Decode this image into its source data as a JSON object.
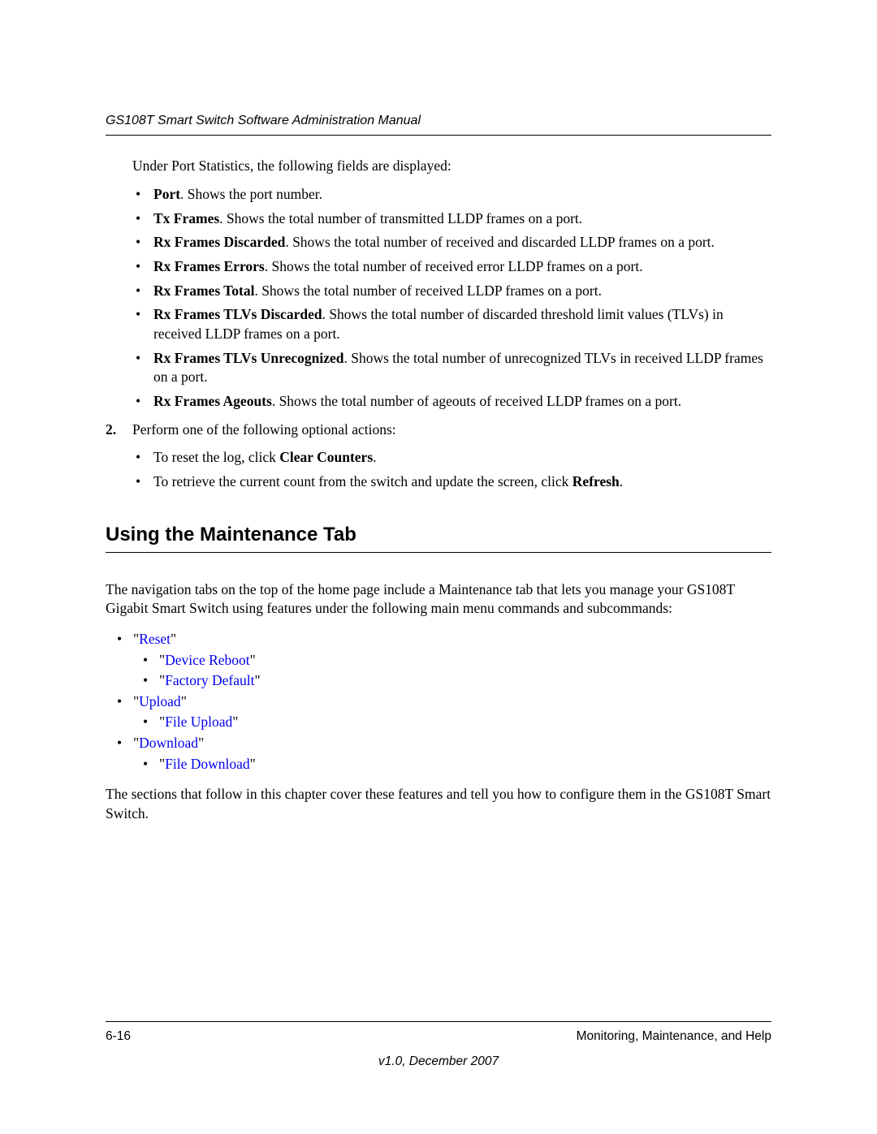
{
  "header": {
    "title": "GS108T Smart Switch Software Administration Manual"
  },
  "intro": "Under Port Statistics, the following fields are displayed:",
  "fields": [
    {
      "term": "Port",
      "desc": ". Shows the port number."
    },
    {
      "term": "Tx Frames",
      "desc": ". Shows the total number of transmitted LLDP frames on a port."
    },
    {
      "term": "Rx Frames Discarded",
      "desc": ". Shows the total number of received and discarded LLDP frames on a port."
    },
    {
      "term": "Rx Frames Errors",
      "desc": ". Shows the total number of received error LLDP frames on a port."
    },
    {
      "term": "Rx Frames Total",
      "desc": ". Shows the total number of received LLDP frames on a port."
    },
    {
      "term": "Rx Frames TLVs Discarded",
      "desc": ". Shows the total number of discarded threshold limit values (TLVs) in received LLDP frames on a port."
    },
    {
      "term": "Rx Frames TLVs Unrecognized",
      "desc": ". Shows the total number of unrecognized TLVs in received LLDP frames on a port."
    },
    {
      "term": "Rx Frames Ageouts",
      "desc": ". Shows the total number of ageouts of received LLDP frames on a port."
    }
  ],
  "step": {
    "num": "2.",
    "text": "Perform one of the following optional actions:"
  },
  "actions": {
    "a1_pre": "To reset the log, click ",
    "a1_bold": "Clear Counters",
    "a1_post": ".",
    "a2_pre": "To retrieve the current count from the switch and update the screen, click ",
    "a2_bold": "Refresh",
    "a2_post": "."
  },
  "section": {
    "heading": "Using the Maintenance Tab",
    "intro": "The navigation tabs on the top of the home page include a Maintenance tab that lets you manage your GS108T Gigabit Smart Switch using features under the following main menu commands and subcommands:"
  },
  "toc": [
    {
      "label": "Reset",
      "children": [
        {
          "label": "Device Reboot"
        },
        {
          "label": "Factory Default"
        }
      ]
    },
    {
      "label": "Upload",
      "children": [
        {
          "label": "File Upload"
        }
      ]
    },
    {
      "label": "Download",
      "children": [
        {
          "label": "File Download"
        }
      ]
    }
  ],
  "closing": "The sections that follow in this chapter cover these features and tell you how to configure them in the GS108T Smart Switch.",
  "footer": {
    "page_num": "6-16",
    "chapter": "Monitoring, Maintenance, and Help",
    "version": "v1.0, December 2007"
  }
}
